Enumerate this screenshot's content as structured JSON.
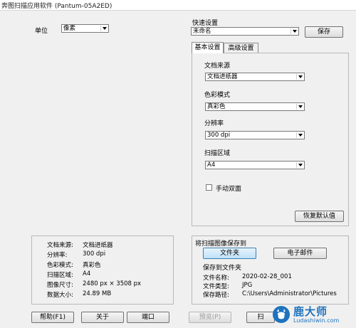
{
  "window": {
    "title": "奔图扫描应用软件 (Pantum-05A2ED)"
  },
  "unit": {
    "label": "单位",
    "value": "像素"
  },
  "quick": {
    "label": "快速设置",
    "value": "未命名",
    "save": "保存"
  },
  "tabs": [
    {
      "label": "基本设置"
    },
    {
      "label": "高级设置"
    }
  ],
  "settings": {
    "source": {
      "label": "文档来源",
      "value": "文档进纸器"
    },
    "color": {
      "label": "色彩模式",
      "value": "真彩色"
    },
    "res": {
      "label": "分辨率",
      "value": "300 dpi"
    },
    "area": {
      "label": "扫描区域",
      "value": "A4"
    },
    "duplex": {
      "label": "手动双面",
      "checked": false
    },
    "defaults": "恢复默认值"
  },
  "info": [
    {
      "k": "文档来源:",
      "v": "文档进纸器"
    },
    {
      "k": "分辨率:",
      "v": "300 dpi"
    },
    {
      "k": "色彩模式:",
      "v": "真彩色"
    },
    {
      "k": "扫描区域:",
      "v": "A4"
    },
    {
      "k": "图像尺寸:",
      "v": "2480 px × 3508 px"
    },
    {
      "k": "数据大小:",
      "v": "24.89 MB"
    }
  ],
  "save": {
    "title": "将扫描图像保存到",
    "folder_btn": "文件夹",
    "email_btn": "电子邮件",
    "to_folder": "保存到文件夹",
    "rows": [
      {
        "k": "文件名称:",
        "v": "2020-02-28_001"
      },
      {
        "k": "文件类型:",
        "v": "JPG"
      },
      {
        "k": "保存路径:",
        "v": "C:\\Users\\Administrator\\Pictures"
      }
    ]
  },
  "bottom": {
    "help": "帮助(F1)",
    "about": "关于",
    "port": "端口",
    "preview": "预览(P)",
    "scan": "扫"
  },
  "watermark": {
    "brand": "鹿大师",
    "url": "Ludashiwin.com"
  }
}
